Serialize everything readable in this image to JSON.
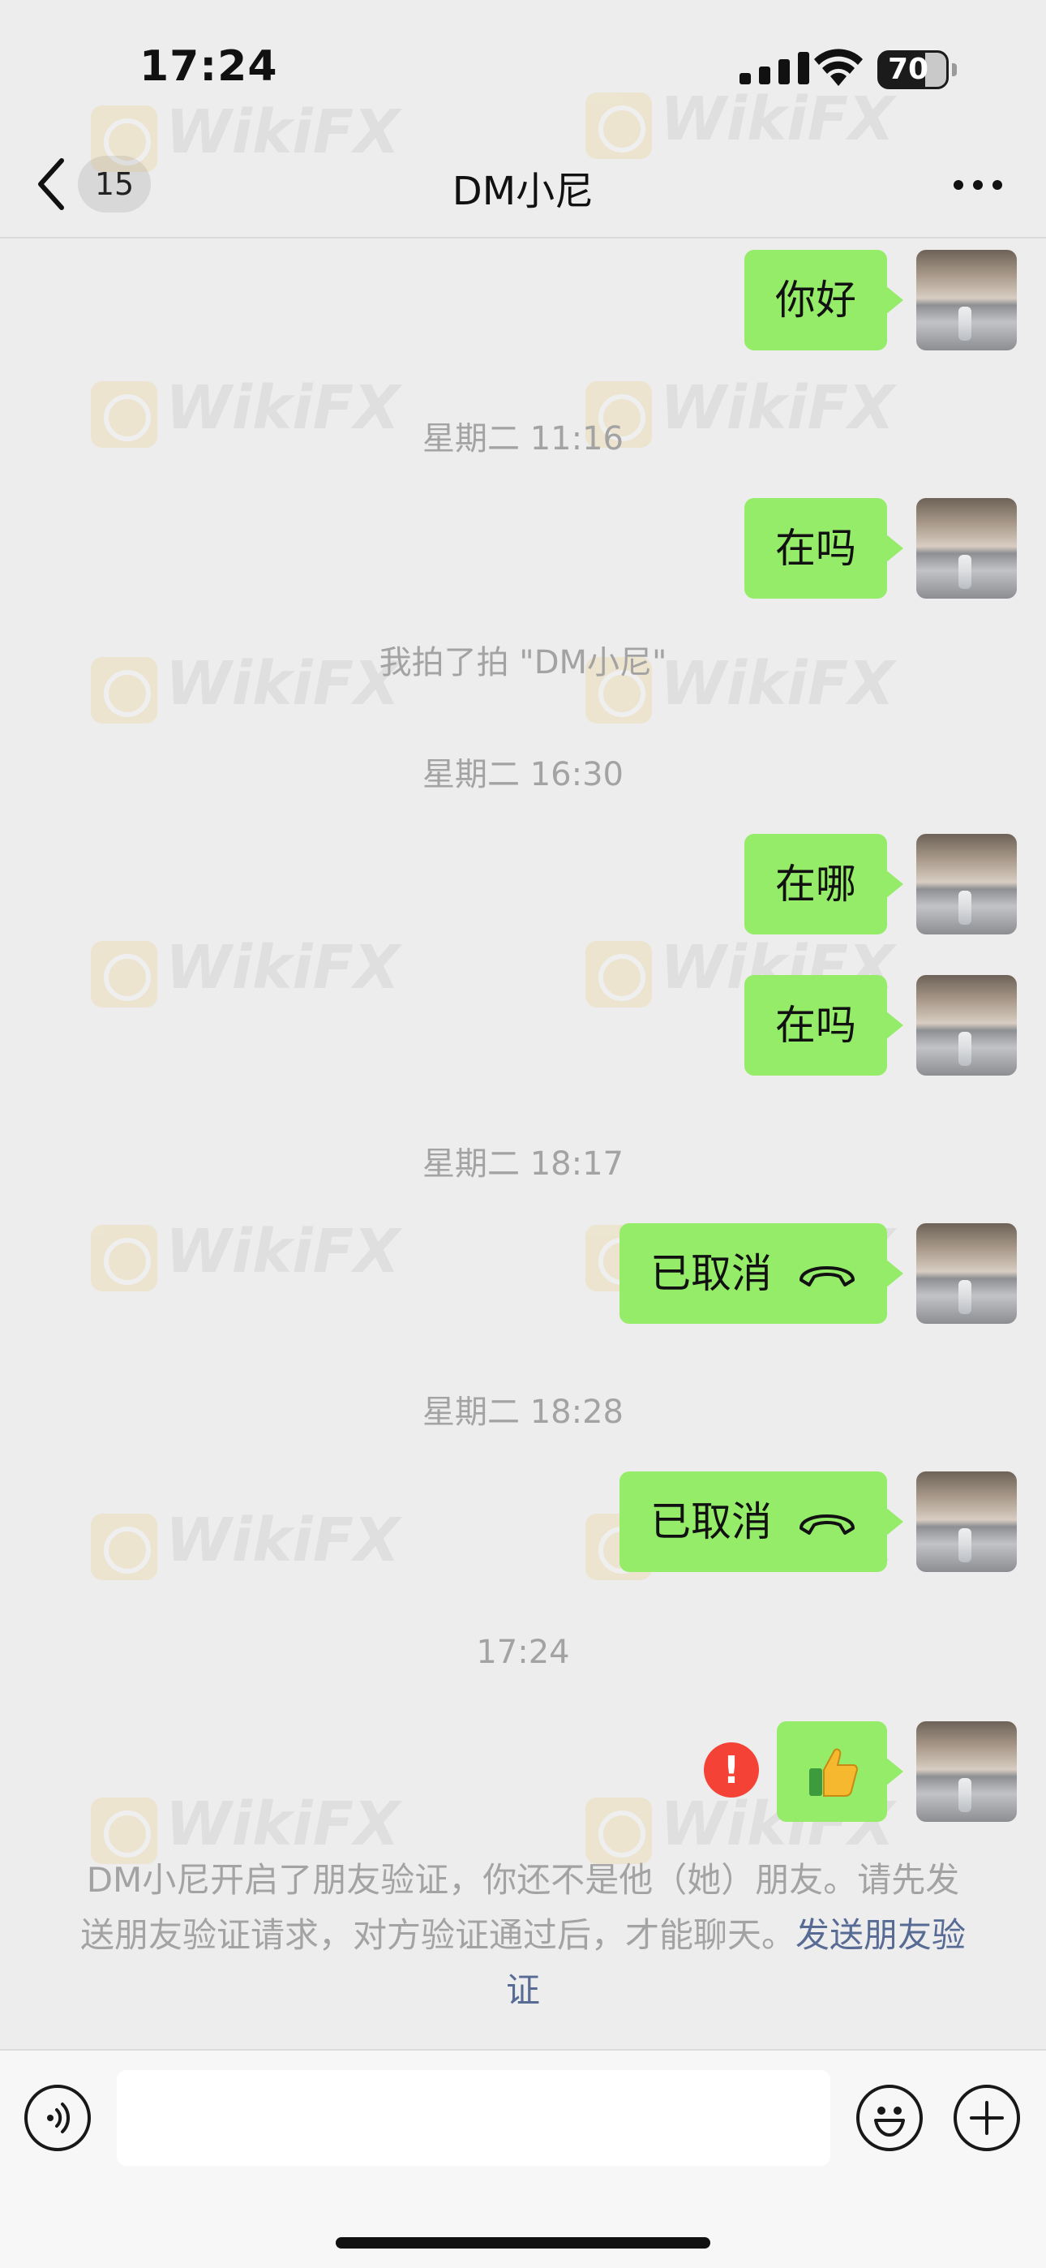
{
  "status_bar": {
    "time": "17:24",
    "battery": "70",
    "battery_level_percent": 70
  },
  "nav": {
    "unread_count": "15",
    "title": "DM小尼"
  },
  "watermark": {
    "text": "WikiFX"
  },
  "messages": [
    {
      "kind": "sent-text",
      "text": "你好"
    },
    {
      "kind": "timestamp",
      "text": "星期二 11:16"
    },
    {
      "kind": "sent-text",
      "text": "在吗"
    },
    {
      "kind": "system",
      "text": "我拍了拍 \"DM小尼\""
    },
    {
      "kind": "timestamp",
      "text": "星期二 16:30"
    },
    {
      "kind": "sent-text",
      "text": "在哪"
    },
    {
      "kind": "sent-text",
      "text": "在吗"
    },
    {
      "kind": "timestamp",
      "text": "星期二 18:17"
    },
    {
      "kind": "sent-call",
      "text": "已取消",
      "icon": "hangup-icon"
    },
    {
      "kind": "timestamp",
      "text": "星期二 18:28"
    },
    {
      "kind": "sent-call",
      "text": "已取消",
      "icon": "hangup-icon"
    },
    {
      "kind": "timestamp",
      "text": "17:24"
    },
    {
      "kind": "sent-emoji-failed",
      "icon": "thumbs-up-icon",
      "status": "send-failed"
    }
  ],
  "notice": {
    "text": "DM小尼开启了朋友验证，你还不是他（她）朋友。请先发送朋友验证请求，对方验证通过后，才能聊天。",
    "link": "发送朋友验证"
  },
  "input_bar": {
    "voice_icon": "voice-icon",
    "emoji_icon": "emoji-icon",
    "more_icon": "plus-icon"
  },
  "colors": {
    "bubble": "#95ec69",
    "background": "#ededed",
    "link": "#576b95",
    "error": "#f44336"
  }
}
